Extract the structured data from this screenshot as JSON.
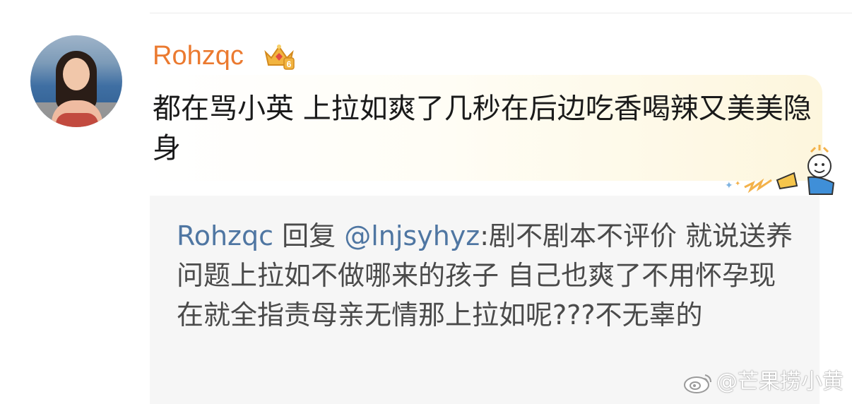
{
  "comment": {
    "username": "Rohzqc",
    "badge_level": "6",
    "badge_icon": "crown-badge-icon",
    "text": "都在骂小英 上拉如爽了几秒在后边吃香喝辣又美美隐身"
  },
  "reply": {
    "username": "Rohzqc",
    "action": "回复",
    "mention": "@lnjsyhyz",
    "text": ":剧不剧本不评价 就说送养问题上拉如不做哪来的孩子 自己也爽了不用怀孕现在就全指责母亲无情那上拉如呢???不无辜的"
  },
  "watermark": {
    "text": "@芒果捞小黄",
    "icon": "weibo-logo-icon"
  },
  "colors": {
    "username": "#eb7a30",
    "link": "#4f76a2",
    "reply_bg": "#f6f6f6"
  }
}
